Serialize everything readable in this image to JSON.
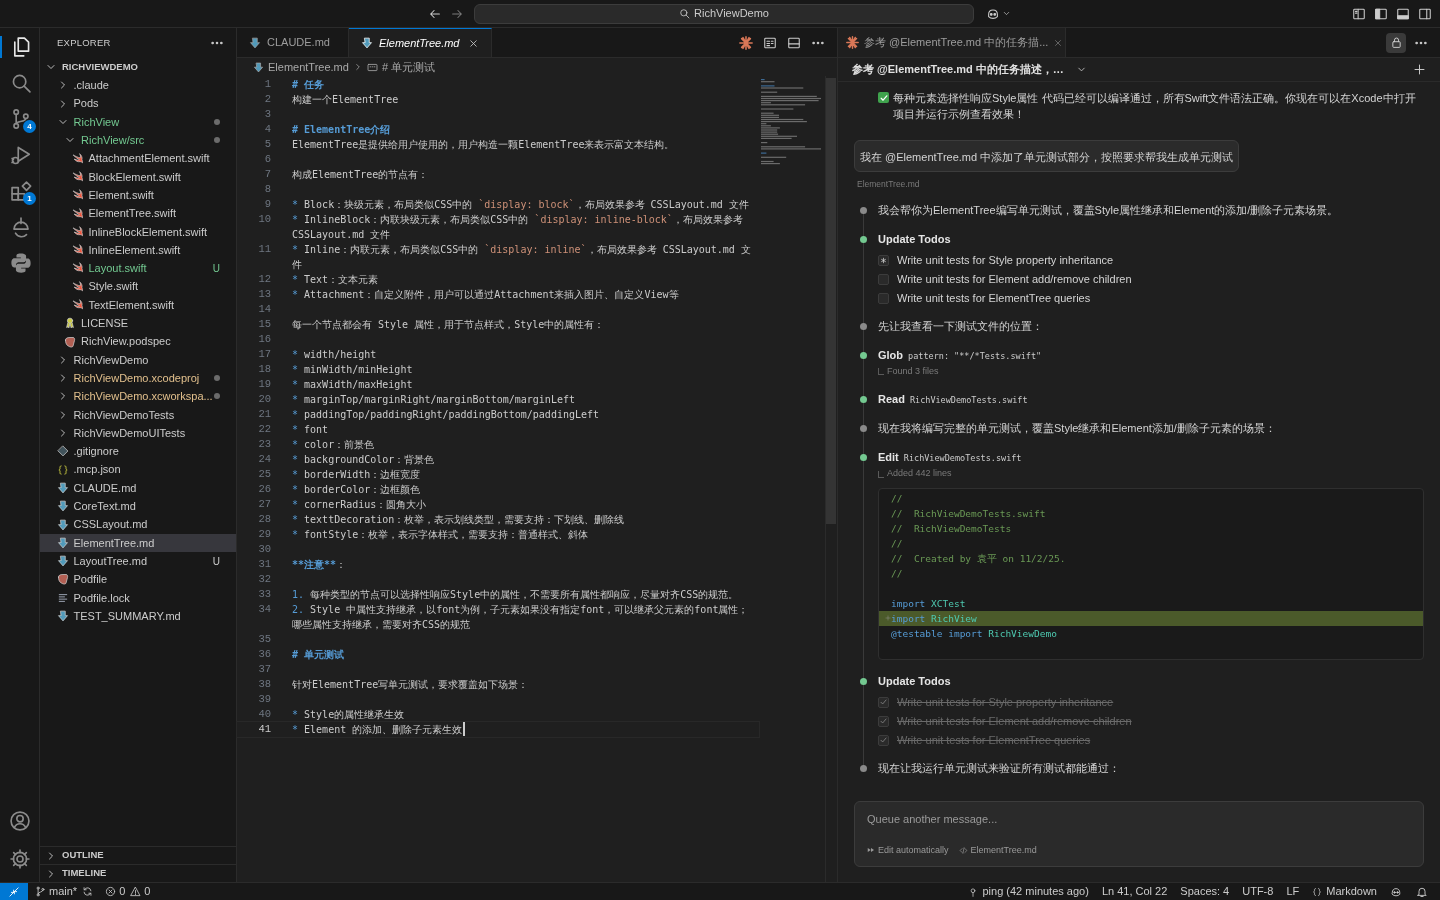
{
  "title_bar": {
    "search": "RichViewDemo"
  },
  "activity_bar": {
    "items": [
      {
        "kind": "files",
        "selected": true
      },
      {
        "kind": "search",
        "selected": false
      },
      {
        "kind": "source-control",
        "selected": false,
        "badge": "4"
      },
      {
        "kind": "run",
        "selected": false
      },
      {
        "kind": "extensions",
        "selected": false,
        "badge": "1"
      },
      {
        "kind": "remote",
        "selected": false
      },
      {
        "kind": "python",
        "selected": false
      }
    ],
    "bottom": [
      {
        "kind": "account"
      },
      {
        "kind": "settings"
      }
    ]
  },
  "sidebar": {
    "title": "EXPLORER",
    "root": {
      "label": "RICHVIEWDEMO",
      "expanded": true,
      "children": [
        {
          "label": ".claude",
          "kind": "folder",
          "expanded": false,
          "selected": false
        },
        {
          "label": "Pods",
          "kind": "folder",
          "expanded": false,
          "selected": false
        },
        {
          "label": "RichView",
          "kind": "folder",
          "expanded": true,
          "selected": false,
          "color": "#73c991",
          "children": [
            {
              "label": "RichView/src",
              "kind": "folder",
              "expanded": true,
              "selected": false,
              "color": "#73c991",
              "children": [
                {
                  "label": "AttachmentElement.swift",
                  "kind": "swift",
                  "selected": false
                },
                {
                  "label": "BlockElement.swift",
                  "kind": "swift",
                  "selected": false
                },
                {
                  "label": "Element.swift",
                  "kind": "swift",
                  "selected": false
                },
                {
                  "label": "ElementTree.swift",
                  "kind": "swift",
                  "selected": false
                },
                {
                  "label": "InlineBlockElement.swift",
                  "kind": "swift",
                  "selected": false
                },
                {
                  "label": "InlineElement.swift",
                  "kind": "swift",
                  "selected": false
                },
                {
                  "label": "Layout.swift",
                  "kind": "swift",
                  "selected": false,
                  "color": "#73c991",
                  "badge": "U"
                },
                {
                  "label": "Style.swift",
                  "kind": "swift",
                  "selected": false
                },
                {
                  "label": "TextElement.swift",
                  "kind": "swift",
                  "selected": false
                }
              ]
            },
            {
              "label": "LICENSE",
              "kind": "license",
              "selected": false
            },
            {
              "label": "RichView.podspec",
              "kind": "ruby",
              "selected": false
            }
          ]
        },
        {
          "label": "RichViewDemo",
          "kind": "folder",
          "expanded": false,
          "selected": false
        },
        {
          "label": "RichViewDemo.xcodeproj",
          "kind": "folder",
          "expanded": false,
          "selected": false,
          "color": "#e2c08d"
        },
        {
          "label": "RichViewDemo.xcworkspa...",
          "kind": "folder",
          "expanded": false,
          "selected": false,
          "color": "#e2c08d"
        },
        {
          "label": "RichViewDemoTests",
          "kind": "folder",
          "expanded": false,
          "selected": false
        },
        {
          "label": "RichViewDemoUITests",
          "kind": "folder",
          "expanded": false,
          "selected": false
        },
        {
          "label": ".gitignore",
          "kind": "git",
          "selected": false
        },
        {
          "label": ".mcp.json",
          "kind": "json",
          "selected": false
        },
        {
          "label": "CLAUDE.md",
          "kind": "md",
          "selected": false
        },
        {
          "label": "CoreText.md",
          "kind": "md",
          "selected": false
        },
        {
          "label": "CSSLayout.md",
          "kind": "md",
          "selected": false
        },
        {
          "label": "ElementTree.md",
          "kind": "md",
          "selected": true
        },
        {
          "label": "LayoutTree.md",
          "kind": "md",
          "selected": false,
          "badge": "U"
        },
        {
          "label": "Podfile",
          "kind": "ruby",
          "selected": false
        },
        {
          "label": "Podfile.lock",
          "kind": "lock",
          "selected": false
        },
        {
          "label": "TEST_SUMMARY.md",
          "kind": "md",
          "selected": false
        }
      ]
    },
    "sections": [
      {
        "label": "OUTLINE",
        "expanded": false
      },
      {
        "label": "TIMELINE",
        "expanded": false
      }
    ]
  },
  "editor": {
    "tabs": [
      {
        "label": "CLAUDE.md",
        "selected": false,
        "preview": false
      },
      {
        "label": "ElementTree.md",
        "selected": true,
        "preview": true
      }
    ],
    "breadcrumb": [
      "ElementTree.md",
      "# 单元测试"
    ],
    "lines": [
      {
        "number": "1",
        "current": false,
        "parts": [
          {
            "kind": "heading",
            "text": "# 任务"
          }
        ]
      },
      {
        "number": "2",
        "current": false,
        "parts": [
          {
            "kind": "plain",
            "text": "构建一个ElementTree"
          }
        ]
      },
      {
        "number": "3",
        "current": false
      },
      {
        "number": "4",
        "current": false,
        "parts": [
          {
            "kind": "heading",
            "text": "# ElementTree介绍"
          }
        ]
      },
      {
        "number": "5",
        "current": false,
        "parts": [
          {
            "kind": "plain",
            "text": "ElementTree是提供给用户使用的，用户构造一颗ElementTree来表示富文本结构。"
          }
        ]
      },
      {
        "number": "6",
        "current": false
      },
      {
        "number": "7",
        "current": false,
        "parts": [
          {
            "kind": "plain",
            "text": "构成ElementTree的节点有："
          }
        ]
      },
      {
        "number": "8",
        "current": false
      },
      {
        "number": "9",
        "current": false,
        "parts": [
          {
            "kind": "marker",
            "text": "* "
          },
          {
            "kind": "plain",
            "text": "Block：块级元素，布局类似CSS中的 "
          },
          {
            "kind": "code",
            "text": "`display: block`"
          },
          {
            "kind": "plain",
            "text": "，布局效果参考 CSSLayout.md 文件"
          }
        ]
      },
      {
        "number": "10",
        "current": false,
        "parts": [
          {
            "kind": "marker",
            "text": "* "
          },
          {
            "kind": "plain",
            "text": "InlineBlock：内联块级元素，布局类似CSS中的 "
          },
          {
            "kind": "code",
            "text": "`display: inline-block`"
          },
          {
            "kind": "plain",
            "text": "，布局效果参考 CSSLayout.md 文件"
          }
        ]
      },
      {
        "number": "11",
        "current": false,
        "parts": [
          {
            "kind": "marker",
            "text": "* "
          },
          {
            "kind": "plain",
            "text": "Inline：内联元素，布局类似CSS中的 "
          },
          {
            "kind": "code",
            "text": "`display: inline`"
          },
          {
            "kind": "plain",
            "text": "，布局效果参考 CSSLayout.md 文件"
          }
        ]
      },
      {
        "number": "12",
        "current": false,
        "parts": [
          {
            "kind": "marker",
            "text": "* "
          },
          {
            "kind": "plain",
            "text": "Text：文本元素"
          }
        ]
      },
      {
        "number": "13",
        "current": false,
        "parts": [
          {
            "kind": "marker",
            "text": "* "
          },
          {
            "kind": "plain",
            "text": "Attachment：自定义附件，用户可以通过Attachment来插入图片、自定义View等"
          }
        ]
      },
      {
        "number": "14",
        "current": false
      },
      {
        "number": "15",
        "current": false,
        "parts": [
          {
            "kind": "plain",
            "text": "每一个节点都会有 Style 属性，用于节点样式，Style中的属性有："
          }
        ]
      },
      {
        "number": "16",
        "current": false
      },
      {
        "number": "17",
        "current": false,
        "parts": [
          {
            "kind": "marker",
            "text": "* "
          },
          {
            "kind": "plain",
            "text": "width/height"
          }
        ]
      },
      {
        "number": "18",
        "current": false,
        "parts": [
          {
            "kind": "marker",
            "text": "* "
          },
          {
            "kind": "plain",
            "text": "minWidth/minHeight"
          }
        ]
      },
      {
        "number": "19",
        "current": false,
        "parts": [
          {
            "kind": "marker",
            "text": "* "
          },
          {
            "kind": "plain",
            "text": "maxWidth/maxHeight"
          }
        ]
      },
      {
        "number": "20",
        "current": false,
        "parts": [
          {
            "kind": "marker",
            "text": "* "
          },
          {
            "kind": "plain",
            "text": "marginTop/marginRight/marginBottom/marginLeft"
          }
        ]
      },
      {
        "number": "21",
        "current": false,
        "parts": [
          {
            "kind": "marker",
            "text": "* "
          },
          {
            "kind": "plain",
            "text": "paddingTop/paddingRight/paddingBottom/paddingLeft"
          }
        ]
      },
      {
        "number": "22",
        "current": false,
        "parts": [
          {
            "kind": "marker",
            "text": "* "
          },
          {
            "kind": "plain",
            "text": "font"
          }
        ]
      },
      {
        "number": "23",
        "current": false,
        "parts": [
          {
            "kind": "marker",
            "text": "* "
          },
          {
            "kind": "plain",
            "text": "color：前景色"
          }
        ]
      },
      {
        "number": "24",
        "current": false,
        "parts": [
          {
            "kind": "marker",
            "text": "* "
          },
          {
            "kind": "plain",
            "text": "backgroundColor：背景色"
          }
        ]
      },
      {
        "number": "25",
        "current": false,
        "parts": [
          {
            "kind": "marker",
            "text": "* "
          },
          {
            "kind": "plain",
            "text": "borderWidth：边框宽度"
          }
        ]
      },
      {
        "number": "26",
        "current": false,
        "parts": [
          {
            "kind": "marker",
            "text": "* "
          },
          {
            "kind": "plain",
            "text": "borderColor：边框颜色"
          }
        ]
      },
      {
        "number": "27",
        "current": false,
        "parts": [
          {
            "kind": "marker",
            "text": "* "
          },
          {
            "kind": "plain",
            "text": "cornerRadius：圆角大小"
          }
        ]
      },
      {
        "number": "28",
        "current": false,
        "parts": [
          {
            "kind": "marker",
            "text": "* "
          },
          {
            "kind": "plain",
            "text": "texttDecoration：枚举，表示划线类型，需要支持：下划线、删除线"
          }
        ]
      },
      {
        "number": "29",
        "current": false,
        "parts": [
          {
            "kind": "marker",
            "text": "* "
          },
          {
            "kind": "plain",
            "text": "fontStyle：枚举，表示字体样式，需要支持：普通样式、斜体"
          }
        ]
      },
      {
        "number": "30",
        "current": false
      },
      {
        "number": "31",
        "current": false,
        "parts": [
          {
            "kind": "emphasis",
            "text": "**注意**"
          },
          {
            "kind": "plain",
            "text": "："
          }
        ]
      },
      {
        "number": "32",
        "current": false
      },
      {
        "number": "33",
        "current": false,
        "parts": [
          {
            "kind": "marker",
            "text": "1. "
          },
          {
            "kind": "plain",
            "text": "每种类型的节点可以选择性响应Style中的属性，不需要所有属性都响应，尽量对齐CSS的规范。"
          }
        ]
      },
      {
        "number": "34",
        "current": false,
        "parts": [
          {
            "kind": "marker",
            "text": "2. "
          },
          {
            "kind": "plain",
            "text": "Style 中属性支持继承，以font为例，子元素如果没有指定font，可以继承父元素的font属性；哪些属性支持继承，需要对齐CSS的规范"
          }
        ]
      },
      {
        "number": "35",
        "current": false
      },
      {
        "number": "36",
        "current": false,
        "parts": [
          {
            "kind": "heading",
            "text": "# 单元测试"
          }
        ]
      },
      {
        "number": "37",
        "current": false
      },
      {
        "number": "38",
        "current": false,
        "parts": [
          {
            "kind": "plain",
            "text": "针对ElementTree写单元测试，要求覆盖如下场景："
          }
        ]
      },
      {
        "number": "39",
        "current": false
      },
      {
        "number": "40",
        "current": false,
        "parts": [
          {
            "kind": "marker",
            "text": "* "
          },
          {
            "kind": "plain",
            "text": "Style的属性继承生效"
          }
        ]
      },
      {
        "number": "41",
        "current": true,
        "parts": [
          {
            "kind": "marker",
            "text": "* "
          },
          {
            "kind": "plain",
            "text": "Element 的添加、删除子元素生效"
          }
        ]
      }
    ]
  },
  "chat": {
    "tab": "参考 @ElementTree.md 中的任务描...",
    "header": "参考 @ElementTree.md 中的任务描述，…",
    "previous_reply": "每种元素选择性响应Style属性 代码已经可以编译通过，所有Swift文件语法正确。你现在可以在Xcode中打开项目并运行示例查看效果！",
    "user_message": {
      "text": "我在 @ElementTree.md 中添加了单元测试部分，按照要求帮我生成单元测试",
      "attachment": "ElementTree.md"
    },
    "steps": [
      {
        "kind": "text",
        "text": "我会帮你为ElementTree编写单元测试，覆盖Style属性继承和Element的添加/删除子元素场景。"
      },
      {
        "kind": "todos",
        "title": "Update Todos",
        "items": [
          {
            "text": "Write unit tests for Style property inheritance",
            "checked": false,
            "active": true
          },
          {
            "text": "Write unit tests for Element add/remove children",
            "checked": false,
            "active": false
          },
          {
            "text": "Write unit tests for ElementTree queries",
            "checked": false,
            "active": false
          }
        ]
      },
      {
        "kind": "text",
        "text": "先让我查看一下测试文件的位置："
      },
      {
        "kind": "tool",
        "tool": "Glob",
        "argument": "pattern: \"**/*Tests.swift\"",
        "result": "Found 3 files"
      },
      {
        "kind": "tool",
        "tool": "Read",
        "argument": "RichViewDemoTests.swift"
      },
      {
        "kind": "text",
        "text": "现在我将编写完整的单元测试，覆盖Style继承和Element添加/删除子元素的场景："
      },
      {
        "kind": "tool",
        "tool": "Edit",
        "argument": "RichViewDemoTests.swift",
        "result": "Added 442 lines",
        "code": [
          {
            "added": false,
            "parts": [
              {
                "kind": "comment",
                "text": "//"
              }
            ]
          },
          {
            "added": false,
            "parts": [
              {
                "kind": "comment",
                "text": "//  RichViewDemoTests.swift"
              }
            ]
          },
          {
            "added": false,
            "parts": [
              {
                "kind": "comment",
                "text": "//  RichViewDemoTests"
              }
            ]
          },
          {
            "added": false,
            "parts": [
              {
                "kind": "comment",
                "text": "//"
              }
            ]
          },
          {
            "added": false,
            "parts": [
              {
                "kind": "comment",
                "text": "//  Created by 袁平 on 11/2/25."
              }
            ]
          },
          {
            "added": false,
            "parts": [
              {
                "kind": "comment",
                "text": "//"
              }
            ]
          },
          {
            "added": false
          },
          {
            "added": false,
            "parts": [
              {
                "kind": "keyword",
                "text": "import"
              },
              {
                "kind": "type",
                "text": " XCTest"
              }
            ]
          },
          {
            "added": true,
            "parts": [
              {
                "kind": "keyword",
                "text": "import"
              },
              {
                "kind": "type",
                "text": " RichView"
              }
            ]
          },
          {
            "added": false,
            "parts": [
              {
                "kind": "keyword",
                "text": "@testable import"
              },
              {
                "kind": "type",
                "text": " RichViewDemo"
              }
            ]
          }
        ]
      },
      {
        "kind": "todos",
        "title": "Update Todos",
        "items": [
          {
            "text": "Write unit tests for Style property inheritance",
            "checked": true,
            "active": false
          },
          {
            "text": "Write unit tests for Element add/remove children",
            "checked": true,
            "active": false
          },
          {
            "text": "Write unit tests for ElementTree queries",
            "checked": true,
            "active": false
          }
        ]
      },
      {
        "kind": "text",
        "text": "现在让我运行单元测试来验证所有测试都能通过："
      }
    ],
    "input": {
      "placeholder": "Queue another message...",
      "mode": "Edit automatically",
      "context_file": "ElementTree.md"
    }
  },
  "status_bar": {
    "branch": "main*",
    "errors": "0",
    "warnings": "0",
    "right": [
      {
        "kind": "ping",
        "text": "ping (42 minutes ago)"
      },
      {
        "kind": "plain",
        "text": "Ln 41, Col 22"
      },
      {
        "kind": "plain",
        "text": "Spaces: 4"
      },
      {
        "kind": "plain",
        "text": "UTF-8"
      },
      {
        "kind": "plain",
        "text": "LF"
      },
      {
        "kind": "language",
        "text": "Markdown"
      }
    ]
  }
}
